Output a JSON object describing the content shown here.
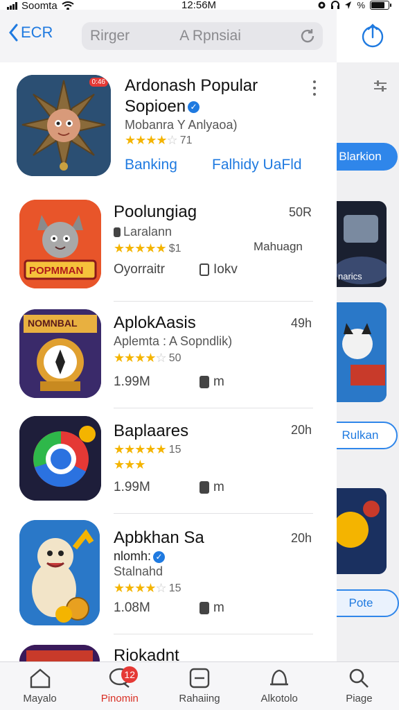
{
  "status_bar": {
    "carrier": "Soomta",
    "time": "12:56M"
  },
  "nav": {
    "back_label": "ECR",
    "search_text_1": "Rirger",
    "search_text_2": "A Rpnsiai"
  },
  "featured": {
    "name_line1": "Ardonash Popular",
    "name_line2": "Sopioen",
    "subtitle": "Mobanra Y Anlyaoa)",
    "rating_count": "71",
    "stars": 4,
    "link_left": "Banking",
    "link_right": "Falhidy UaFld",
    "icon_badge": "0:46"
  },
  "apps": [
    {
      "name": "Poolungiag",
      "developer": "Laralann",
      "age": "50R",
      "rating_count": "$1",
      "stars": 5,
      "meta_left": "Oyorraitr",
      "meta_right": "Iokv",
      "extra_right": "Mahuagn",
      "icon_text": "POPMMAN"
    },
    {
      "name": "AplokAasis",
      "developer": "Aplemta : A Sopndlik)",
      "age": "49h",
      "rating_count": "50",
      "stars": 4,
      "meta_left": "1.99M",
      "meta_right": "m",
      "icon_text": "NOMNBAL"
    },
    {
      "name": "Baplaares",
      "developer": "",
      "age": "20h",
      "rating_count": "15",
      "stars": 5,
      "meta_left": "1.99M",
      "meta_right": "m"
    },
    {
      "name": "Apbkhan Sa",
      "developer_line": "nlomh:",
      "developer": "Stalnahd",
      "age": "20h",
      "rating_count": "15",
      "stars": 4,
      "meta_left": "1.08M",
      "meta_right": "m"
    },
    {
      "name": "Riokadnt"
    }
  ],
  "right_column": {
    "pill_1": "Blarkion",
    "thumb_1_label": "narics",
    "pill_2": "Rulkan",
    "pill_3": "Pote"
  },
  "tabs": [
    {
      "label": "Mayalo",
      "icon": "home-icon"
    },
    {
      "label": "Pinomin",
      "icon": "chat-icon",
      "badge": "12",
      "active": true
    },
    {
      "label": "Rahaiing",
      "icon": "apps-icon"
    },
    {
      "label": "Alkotolo",
      "icon": "bell-icon"
    },
    {
      "label": "Piage",
      "icon": "search-icon"
    }
  ],
  "colors": {
    "accent": "#1f7ae0",
    "star": "#f4b400",
    "badge": "#e53935",
    "active_tab": "#d93025"
  }
}
